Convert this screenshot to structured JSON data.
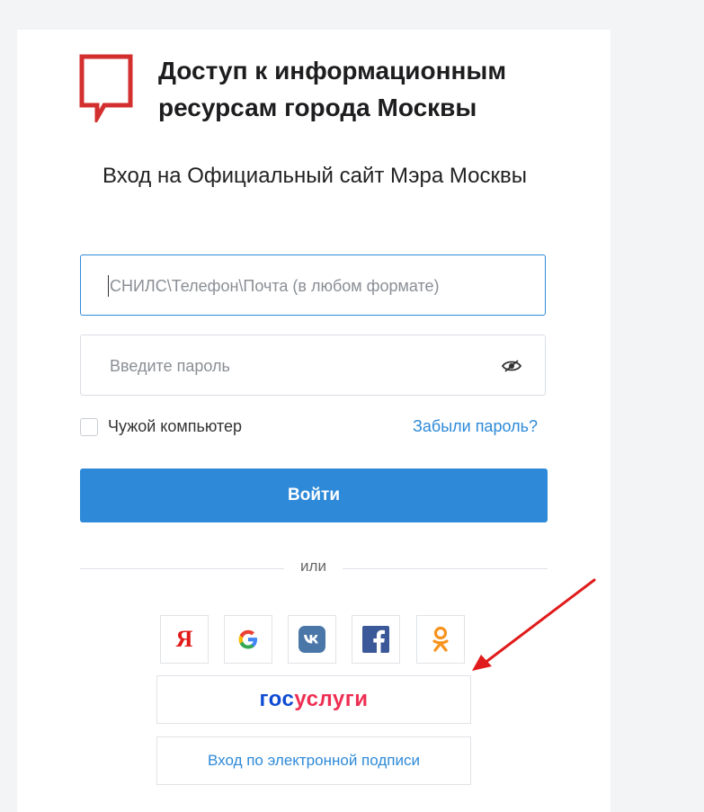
{
  "header": {
    "brand_title": "Доступ к информационным ресурсам города Москвы",
    "logo_icon": "speech-bubble-logo"
  },
  "form": {
    "subtitle": "Вход на Официальный сайт Мэра Москвы",
    "login_placeholder": "СНИЛС\\Телефон\\Почта (в любом формате)",
    "login_value": "",
    "password_placeholder": "Введите пароль",
    "password_value": "",
    "remember_label": "Чужой компьютер",
    "remember_checked": false,
    "forgot_link": "Забыли пароль?",
    "submit_label": "Войти",
    "divider_text": "или"
  },
  "social": {
    "providers": [
      {
        "name": "yandex",
        "glyph": "Я",
        "color": "#e21a1a"
      },
      {
        "name": "google",
        "icon": "google-icon"
      },
      {
        "name": "vk",
        "icon": "vk-icon",
        "color": "#4a76a8"
      },
      {
        "name": "facebook",
        "icon": "facebook-icon",
        "color": "#3b5998"
      },
      {
        "name": "odnoklassniki",
        "icon": "ok-icon",
        "color": "#f7931e"
      }
    ],
    "gosuslugi_part1": "гос",
    "gosuslugi_part2": "услуги",
    "eds_label": "Вход по электронной подписи"
  },
  "colors": {
    "accent": "#2e8ad8",
    "logo_red": "#d32f2f",
    "annotation_arrow": "#e01b1b",
    "gosuslugi_blue": "#0d4cd3",
    "gosuslugi_red": "#ee2f53"
  }
}
